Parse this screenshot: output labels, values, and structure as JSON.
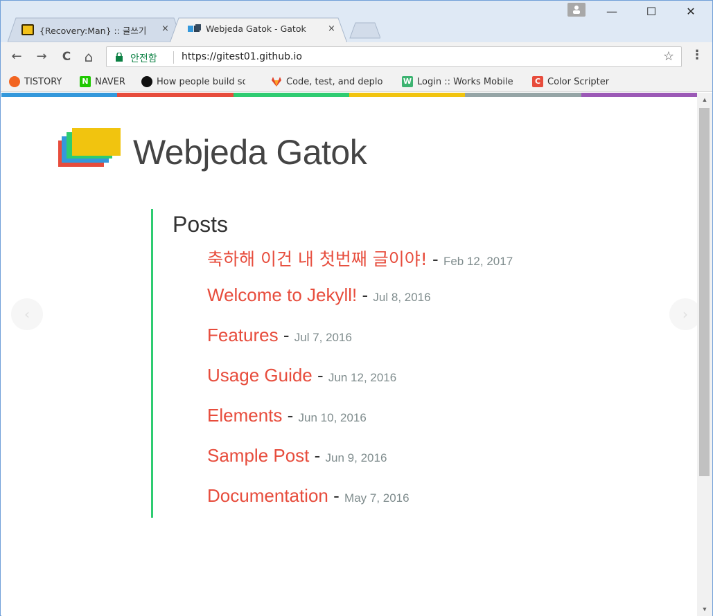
{
  "tabs": [
    {
      "title": "{Recovery:Man} :: 글쓰기",
      "close": "×",
      "icon": "tistory-editor-icon"
    },
    {
      "title": "Webjeda Gatok - Gatok",
      "close": "×",
      "icon": "gatok-site-icon"
    }
  ],
  "window_controls": {
    "minimize": "—",
    "maximize": "☐",
    "close": "✕"
  },
  "toolbar": {
    "back": "←",
    "forward": "→",
    "reload": "C",
    "home": "⌂",
    "security_label": "안전함",
    "url": "https://gitest01.github.io",
    "bookmark_star": "☆",
    "menu": "⋮"
  },
  "bookmarks": [
    {
      "label": "TISTORY",
      "icon": "tistory-icon",
      "color": "#f26522"
    },
    {
      "label": "NAVER",
      "icon": "naver-icon",
      "color": "#1ec800"
    },
    {
      "label": "How people build so",
      "icon": "github-icon",
      "color": "#111111"
    },
    {
      "label": "Code, test, and deplo",
      "icon": "gitlab-icon",
      "color": "#e24329"
    },
    {
      "label": "Login :: Works Mobile",
      "icon": "works-mobile-icon",
      "color": "#3cb371"
    },
    {
      "label": "Color Scripter",
      "icon": "color-scripter-icon",
      "color": "#e74c3c"
    }
  ],
  "colors": {
    "accent_link": "#e74c3c",
    "section_border": "#2ecc71",
    "bar": [
      "#3498db",
      "#e74c3c",
      "#2ecc71",
      "#f1c40f",
      "#95a5a6",
      "#9b59b6"
    ]
  },
  "site": {
    "title": "Webjeda Gatok"
  },
  "posts": {
    "heading": "Posts",
    "items": [
      {
        "title": "축하해 이건 내 첫번째 글이야!",
        "dash": "-",
        "date": "Feb 12, 2017"
      },
      {
        "title": "Welcome to Jekyll!",
        "dash": "-",
        "date": "Jul 8, 2016"
      },
      {
        "title": "Features",
        "dash": "-",
        "date": "Jul 7, 2016"
      },
      {
        "title": "Usage Guide",
        "dash": "-",
        "date": "Jun 12, 2016"
      },
      {
        "title": "Elements",
        "dash": "-",
        "date": "Jun 10, 2016"
      },
      {
        "title": "Sample Post",
        "dash": "-",
        "date": "Jun 9, 2016"
      },
      {
        "title": "Documentation",
        "dash": "-",
        "date": "May 7, 2016"
      }
    ]
  },
  "carousel": {
    "prev": "‹",
    "next": "›"
  }
}
